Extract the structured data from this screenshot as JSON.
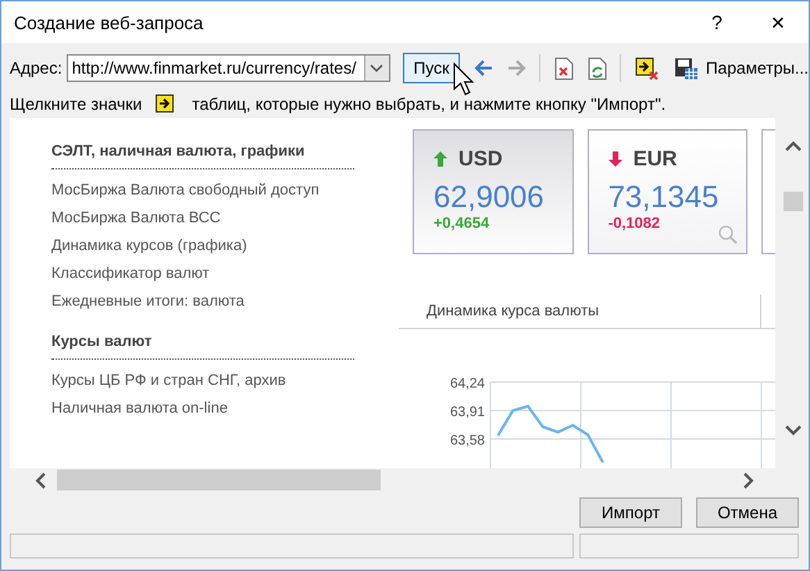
{
  "window": {
    "title": "Создание веб-запроса",
    "help": "?",
    "close": "✕"
  },
  "address": {
    "label": "Адрес:",
    "value": "http://www.finmarket.ru/currency/rates/"
  },
  "go_button": "Пуск",
  "toolbar": [
    {
      "kind": "back",
      "disabled": false
    },
    {
      "kind": "forward",
      "disabled": true
    },
    {
      "kind": "stop"
    },
    {
      "kind": "refresh"
    },
    {
      "kind": "import"
    },
    {
      "kind": "save"
    }
  ],
  "options_button": "Параметры...",
  "instruction": {
    "before": "Щелкните значки",
    "after": "таблиц, которые нужно выбрать, и нажмите кнопку \"Импорт\"."
  },
  "page": {
    "sections": [
      {
        "heading": "СЭЛТ, наличная валюта, графики",
        "links": [
          "МосБиржа Валюта свободный доступ",
          "МосБиржа Валюта ВСС",
          "Динамика курсов (графика)",
          "Классификатор валют",
          "Ежедневные итоги: валюта"
        ]
      },
      {
        "heading": "Курсы валют",
        "links": [
          "Курсы ЦБ РФ и стран СНГ, архив",
          "Наличная валюта on-line"
        ]
      }
    ],
    "cards": [
      {
        "code": "USD",
        "rising": true,
        "rate": "62,9006",
        "change": "+0,4654",
        "magnifier": false,
        "selected": true
      },
      {
        "code": "EUR",
        "rising": false,
        "rate": "73,1345",
        "change": "-0,1082",
        "magnifier": true,
        "selected": false
      }
    ],
    "tab": "Динамика курса валюты",
    "chart_data": {
      "type": "line",
      "grid": true,
      "yticks": [
        {
          "value": 64.24,
          "label": "64,24"
        },
        {
          "value": 63.91,
          "label": "63,91"
        },
        {
          "value": 63.58,
          "label": "63,58"
        }
      ],
      "ylim": [
        63.25,
        64.24
      ],
      "series": [
        {
          "color": "#6cb4f0",
          "values": [
            63.62,
            63.91,
            63.96,
            63.72,
            63.66,
            63.74,
            63.63,
            63.31,
            null,
            null,
            null,
            null,
            null,
            null,
            null,
            null,
            null,
            null,
            null
          ]
        }
      ]
    }
  },
  "buttons": [
    "Импорт",
    "Отмена"
  ]
}
